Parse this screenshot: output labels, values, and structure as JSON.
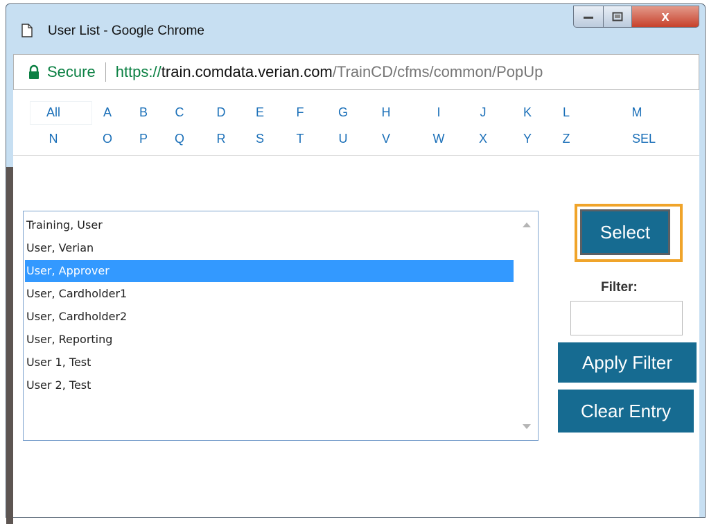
{
  "window": {
    "title": "User List - Google Chrome",
    "controls": {
      "minimize": "minimize-icon",
      "maximize": "maximize-icon",
      "close": "x"
    }
  },
  "address_bar": {
    "secure_label": "Secure",
    "url_scheme": "https://",
    "url_host": "train.comdata.verian.com",
    "url_path": "/TrainCD/cfms/common/PopUp"
  },
  "alphabet": {
    "row1": [
      "All",
      "A",
      "B",
      "C",
      "D",
      "E",
      "F",
      "G",
      "H",
      "I",
      "J",
      "K",
      "L",
      "M"
    ],
    "row2": [
      "N",
      "O",
      "P",
      "Q",
      "R",
      "S",
      "T",
      "U",
      "V",
      "W",
      "X",
      "Y",
      "Z",
      "SEL"
    ]
  },
  "user_list": {
    "items": [
      "Training, User",
      "User, Verian",
      "User, Approver",
      "User, Cardholder1",
      "User, Cardholder2",
      "User, Reporting",
      "User 1, Test",
      "User 2, Test"
    ],
    "selected": "User, Approver"
  },
  "actions": {
    "select_label": "Select",
    "filter_label": "Filter:",
    "filter_value": "",
    "apply_filter_label": "Apply Filter",
    "clear_entry_label": "Clear Entry"
  },
  "colors": {
    "button_bg": "#166b91",
    "highlight_outline": "#f0a42a",
    "selected_row": "#3399ff",
    "link_blue": "#1a6fb8",
    "secure_green": "#0b8043"
  }
}
